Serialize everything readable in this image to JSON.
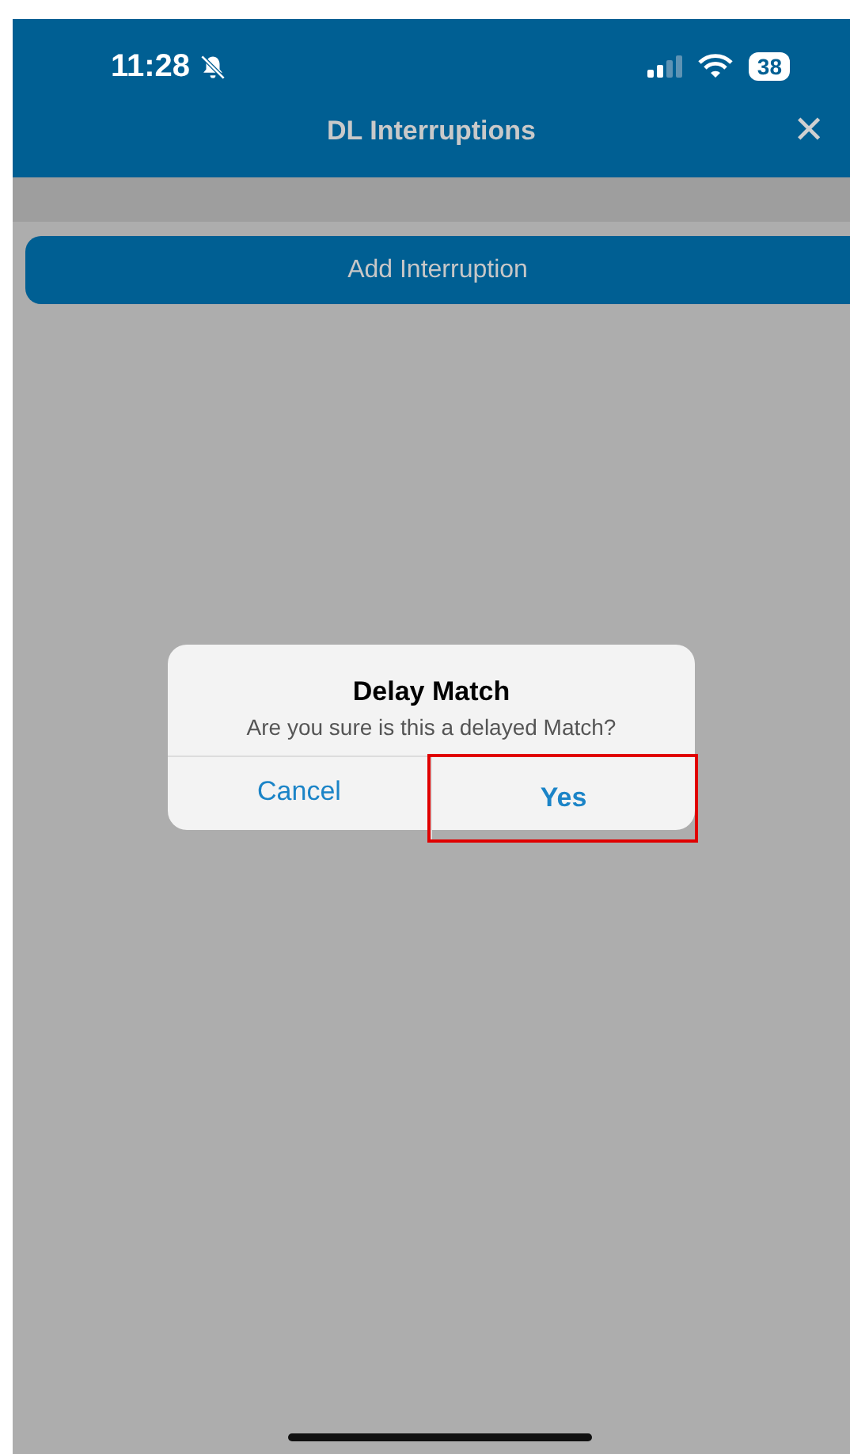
{
  "status_bar": {
    "time": "11:28",
    "muted": true,
    "battery": "38"
  },
  "header": {
    "title": "DL Interruptions",
    "close": "✕"
  },
  "add_button": {
    "label": "Add Interruption"
  },
  "dialog": {
    "title": "Delay Match",
    "message": "Are you sure is this a delayed Match?",
    "buttons": [
      {
        "label": "Cancel",
        "kind": "normal",
        "highlighted": false
      },
      {
        "label": "Yes",
        "kind": "default",
        "highlighted": true
      }
    ]
  }
}
